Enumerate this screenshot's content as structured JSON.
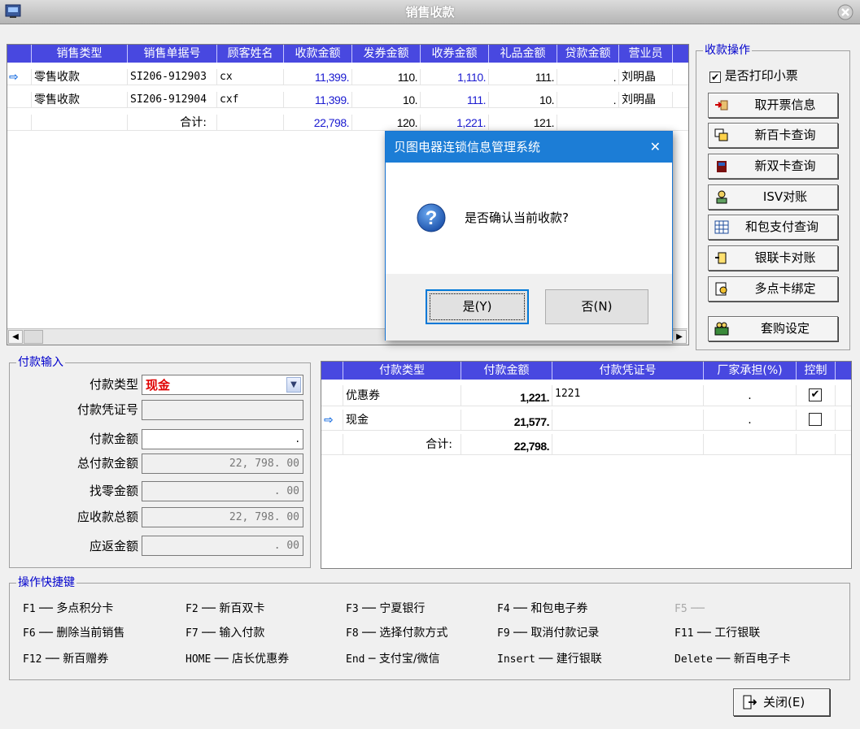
{
  "window": {
    "title": "销售收款"
  },
  "sales_grid": {
    "columns": [
      "销售类型",
      "销售单据号",
      "顾客姓名",
      "收款金额",
      "发券金额",
      "收券金额",
      "礼品金额",
      "贷款金额",
      "营业员"
    ],
    "rows": [
      {
        "pointer": "⇨",
        "type": "零售收款",
        "doc_no": "SI206-912903",
        "customer": "cx",
        "receipt": "11,399.",
        "coupon_issue": "110.",
        "coupon_recv": "1,110.",
        "gift": "111.",
        "loan": ".",
        "clerk": "刘明晶"
      },
      {
        "pointer": "",
        "type": "零售收款",
        "doc_no": "SI206-912904",
        "customer": "cxf",
        "receipt": "11,399.",
        "coupon_issue": "10.",
        "coupon_recv": "111.",
        "gift": "10.",
        "loan": ".",
        "clerk": "刘明晶"
      }
    ],
    "total": {
      "label": "合计:",
      "receipt": "22,798.",
      "coupon_issue": "120.",
      "coupon_recv": "1,221.",
      "gift": "121."
    }
  },
  "ops": {
    "title": "收款操作",
    "print_receipt": {
      "label": "是否打印小票",
      "checked": true
    },
    "buttons": [
      {
        "label": "取开票信息",
        "icon": "invoice-icon"
      },
      {
        "label": "新百卡查询",
        "icon": "card-query-icon"
      },
      {
        "label": "新双卡查询",
        "icon": "dual-card-icon"
      },
      {
        "label": "ISV对账",
        "icon": "reconcile-icon"
      },
      {
        "label": "和包支付查询",
        "icon": "grid-icon"
      },
      {
        "label": "银联卡对账",
        "icon": "unionpay-icon"
      },
      {
        "label": "多点卡绑定",
        "icon": "bind-icon"
      },
      {
        "label": "套购设定",
        "icon": "bundle-icon"
      }
    ]
  },
  "payment_input": {
    "title": "付款输入",
    "type_label": "付款类型",
    "type_value": "现金",
    "voucher_label": "付款凭证号",
    "voucher_value": "",
    "amount_label": "付款金额",
    "amount_value": ".",
    "total_label": "总付款金额",
    "total_value": "22, 798. 00",
    "change_label": "找零金额",
    "change_value": ". 00",
    "receivable_label": "应收款总额",
    "receivable_value": "22, 798. 00",
    "refund_label": "应返金额",
    "refund_value": ". 00"
  },
  "payment_grid": {
    "columns": [
      "付款类型",
      "付款金额",
      "付款凭证号",
      "厂家承担(%)",
      "控制"
    ],
    "rows": [
      {
        "pointer": "",
        "type": "优惠券",
        "amount": "1,221.",
        "voucher": "1221",
        "vendor": ".",
        "control": true
      },
      {
        "pointer": "⇨",
        "type": "现金",
        "amount": "21,577.",
        "voucher": "",
        "vendor": ".",
        "control": false
      }
    ],
    "total": {
      "label": "合计:",
      "amount": "22,798."
    }
  },
  "shortcuts": {
    "title": "操作快捷键",
    "items": [
      {
        "key": "F1",
        "dash": "──",
        "label": "多点积分卡"
      },
      {
        "key": "F2",
        "dash": "──",
        "label": "新百双卡"
      },
      {
        "key": "F3",
        "dash": "──",
        "label": "宁夏银行"
      },
      {
        "key": "F4",
        "dash": "──",
        "label": "和包电子券"
      },
      {
        "key": "F5",
        "dash": "──",
        "label": ""
      },
      {
        "key": "F6",
        "dash": "──",
        "label": "删除当前销售"
      },
      {
        "key": "F7",
        "dash": "──",
        "label": "输入付款"
      },
      {
        "key": "F8",
        "dash": "──",
        "label": "选择付款方式"
      },
      {
        "key": "F9",
        "dash": "──",
        "label": "取消付款记录"
      },
      {
        "key": "F11",
        "dash": "──",
        "label": "工行银联"
      },
      {
        "key": "F12",
        "dash": "──",
        "label": "新百赠券"
      },
      {
        "key": "HOME",
        "dash": "──",
        "label": "店长优惠券"
      },
      {
        "key": "End",
        "dash": "─",
        "label": "支付宝/微信"
      },
      {
        "key": "Insert",
        "dash": "──",
        "label": "建行银联"
      },
      {
        "key": "Delete",
        "dash": "──",
        "label": "新百电子卡"
      }
    ]
  },
  "close_button": {
    "label": "关闭(E)"
  },
  "dialog": {
    "title": "贝图电器连锁信息管理系统",
    "message": "是否确认当前收款?",
    "yes": "是(Y)",
    "no": "否(N)",
    "close_glyph": "✕"
  }
}
